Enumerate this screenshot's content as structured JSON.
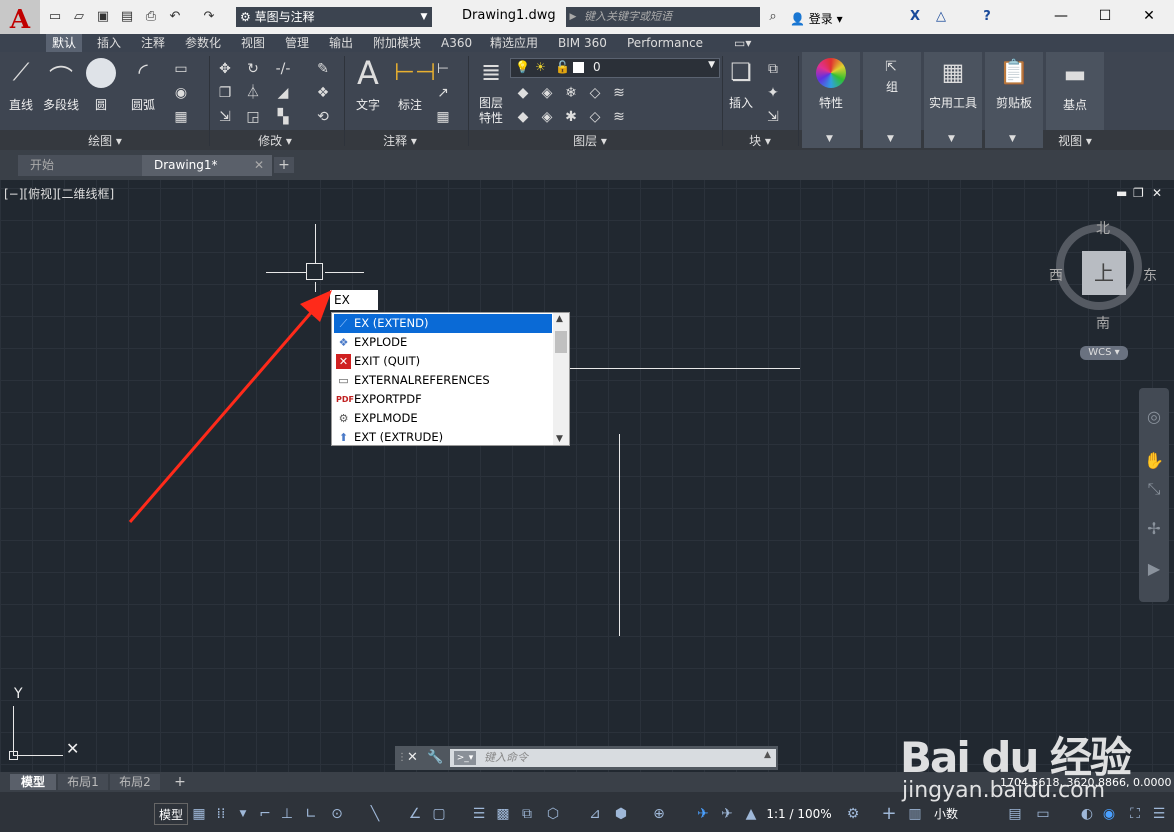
{
  "titlebar": {
    "workspace": "草图与注释",
    "document_title": "Drawing1.dwg",
    "search_placeholder": "键入关键字或短语",
    "login_label": "登录"
  },
  "ribbon_tabs": [
    "默认",
    "插入",
    "注释",
    "参数化",
    "视图",
    "管理",
    "输出",
    "附加模块",
    "A360",
    "精选应用",
    "BIM 360",
    "Performance"
  ],
  "draw_panel": {
    "title": "绘图 ▾",
    "tools": [
      "直线",
      "多段线",
      "圆",
      "圆弧"
    ]
  },
  "modify_panel": {
    "title": "修改 ▾"
  },
  "annotation_panel": {
    "title": "注释 ▾",
    "tools": [
      "文字",
      "标注"
    ]
  },
  "layer_panel": {
    "title": "图层 ▾",
    "tool": "图层\n特性",
    "current_layer": "0"
  },
  "block_panel": {
    "title": "块 ▾",
    "tool": "插入"
  },
  "right_panels": [
    "特性",
    "组",
    "实用工具",
    "剪贴板",
    "基点"
  ],
  "view_panel_title": "视图 ▾",
  "file_tabs": [
    "开始",
    "Drawing1*"
  ],
  "viewport_label": "[−][俯视][二维线框]",
  "viewcube": {
    "north": "北",
    "south": "南",
    "east": "东",
    "west": "西",
    "top": "上",
    "wcs": "WCS"
  },
  "command_input": "EX",
  "autocomplete": [
    {
      "label": "EX (EXTEND)",
      "icon": "extend-icon",
      "selected": true
    },
    {
      "label": "EXPLODE",
      "icon": "explode-icon",
      "selected": false
    },
    {
      "label": "EXIT (QUIT)",
      "icon": "exit-icon",
      "selected": false
    },
    {
      "label": "EXTERNALREFERENCES",
      "icon": "xref-icon",
      "selected": false
    },
    {
      "label": "EXPORTPDF",
      "icon": "pdf-icon",
      "selected": false
    },
    {
      "label": "EXPLMODE",
      "icon": "gear-icon",
      "selected": false
    },
    {
      "label": "EXT (EXTRUDE)",
      "icon": "extrude-icon",
      "selected": false
    }
  ],
  "ucs": {
    "y": "Y"
  },
  "command_line_placeholder": "键入命令",
  "layout_tabs": [
    "模型",
    "布局1",
    "布局2"
  ],
  "coordinates": "1704.5618, 3620.8866, 0.0000",
  "status": {
    "model": "模型",
    "scale": "1:1 / 100%",
    "units": "小数"
  },
  "watermark": {
    "brand": "Bai du 经验",
    "site": "jingyan.baidu.com"
  },
  "colors": {
    "accent": "#0a6ad6",
    "arrow": "#ff2a1a",
    "canvas": "#212830"
  }
}
